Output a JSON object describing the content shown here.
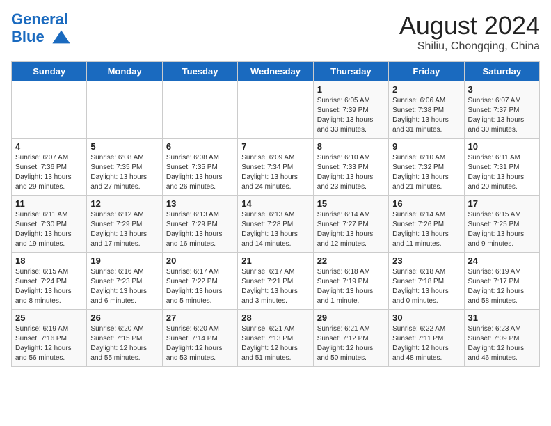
{
  "header": {
    "logo_line1": "General",
    "logo_line2": "Blue",
    "month": "August 2024",
    "location": "Shiliu, Chongqing, China"
  },
  "weekdays": [
    "Sunday",
    "Monday",
    "Tuesday",
    "Wednesday",
    "Thursday",
    "Friday",
    "Saturday"
  ],
  "weeks": [
    [
      {
        "day": "",
        "info": ""
      },
      {
        "day": "",
        "info": ""
      },
      {
        "day": "",
        "info": ""
      },
      {
        "day": "",
        "info": ""
      },
      {
        "day": "1",
        "info": "Sunrise: 6:05 AM\nSunset: 7:39 PM\nDaylight: 13 hours\nand 33 minutes."
      },
      {
        "day": "2",
        "info": "Sunrise: 6:06 AM\nSunset: 7:38 PM\nDaylight: 13 hours\nand 31 minutes."
      },
      {
        "day": "3",
        "info": "Sunrise: 6:07 AM\nSunset: 7:37 PM\nDaylight: 13 hours\nand 30 minutes."
      }
    ],
    [
      {
        "day": "4",
        "info": "Sunrise: 6:07 AM\nSunset: 7:36 PM\nDaylight: 13 hours\nand 29 minutes."
      },
      {
        "day": "5",
        "info": "Sunrise: 6:08 AM\nSunset: 7:35 PM\nDaylight: 13 hours\nand 27 minutes."
      },
      {
        "day": "6",
        "info": "Sunrise: 6:08 AM\nSunset: 7:35 PM\nDaylight: 13 hours\nand 26 minutes."
      },
      {
        "day": "7",
        "info": "Sunrise: 6:09 AM\nSunset: 7:34 PM\nDaylight: 13 hours\nand 24 minutes."
      },
      {
        "day": "8",
        "info": "Sunrise: 6:10 AM\nSunset: 7:33 PM\nDaylight: 13 hours\nand 23 minutes."
      },
      {
        "day": "9",
        "info": "Sunrise: 6:10 AM\nSunset: 7:32 PM\nDaylight: 13 hours\nand 21 minutes."
      },
      {
        "day": "10",
        "info": "Sunrise: 6:11 AM\nSunset: 7:31 PM\nDaylight: 13 hours\nand 20 minutes."
      }
    ],
    [
      {
        "day": "11",
        "info": "Sunrise: 6:11 AM\nSunset: 7:30 PM\nDaylight: 13 hours\nand 19 minutes."
      },
      {
        "day": "12",
        "info": "Sunrise: 6:12 AM\nSunset: 7:29 PM\nDaylight: 13 hours\nand 17 minutes."
      },
      {
        "day": "13",
        "info": "Sunrise: 6:13 AM\nSunset: 7:29 PM\nDaylight: 13 hours\nand 16 minutes."
      },
      {
        "day": "14",
        "info": "Sunrise: 6:13 AM\nSunset: 7:28 PM\nDaylight: 13 hours\nand 14 minutes."
      },
      {
        "day": "15",
        "info": "Sunrise: 6:14 AM\nSunset: 7:27 PM\nDaylight: 13 hours\nand 12 minutes."
      },
      {
        "day": "16",
        "info": "Sunrise: 6:14 AM\nSunset: 7:26 PM\nDaylight: 13 hours\nand 11 minutes."
      },
      {
        "day": "17",
        "info": "Sunrise: 6:15 AM\nSunset: 7:25 PM\nDaylight: 13 hours\nand 9 minutes."
      }
    ],
    [
      {
        "day": "18",
        "info": "Sunrise: 6:15 AM\nSunset: 7:24 PM\nDaylight: 13 hours\nand 8 minutes."
      },
      {
        "day": "19",
        "info": "Sunrise: 6:16 AM\nSunset: 7:23 PM\nDaylight: 13 hours\nand 6 minutes."
      },
      {
        "day": "20",
        "info": "Sunrise: 6:17 AM\nSunset: 7:22 PM\nDaylight: 13 hours\nand 5 minutes."
      },
      {
        "day": "21",
        "info": "Sunrise: 6:17 AM\nSunset: 7:21 PM\nDaylight: 13 hours\nand 3 minutes."
      },
      {
        "day": "22",
        "info": "Sunrise: 6:18 AM\nSunset: 7:19 PM\nDaylight: 13 hours\nand 1 minute."
      },
      {
        "day": "23",
        "info": "Sunrise: 6:18 AM\nSunset: 7:18 PM\nDaylight: 13 hours\nand 0 minutes."
      },
      {
        "day": "24",
        "info": "Sunrise: 6:19 AM\nSunset: 7:17 PM\nDaylight: 12 hours\nand 58 minutes."
      }
    ],
    [
      {
        "day": "25",
        "info": "Sunrise: 6:19 AM\nSunset: 7:16 PM\nDaylight: 12 hours\nand 56 minutes."
      },
      {
        "day": "26",
        "info": "Sunrise: 6:20 AM\nSunset: 7:15 PM\nDaylight: 12 hours\nand 55 minutes."
      },
      {
        "day": "27",
        "info": "Sunrise: 6:20 AM\nSunset: 7:14 PM\nDaylight: 12 hours\nand 53 minutes."
      },
      {
        "day": "28",
        "info": "Sunrise: 6:21 AM\nSunset: 7:13 PM\nDaylight: 12 hours\nand 51 minutes."
      },
      {
        "day": "29",
        "info": "Sunrise: 6:21 AM\nSunset: 7:12 PM\nDaylight: 12 hours\nand 50 minutes."
      },
      {
        "day": "30",
        "info": "Sunrise: 6:22 AM\nSunset: 7:11 PM\nDaylight: 12 hours\nand 48 minutes."
      },
      {
        "day": "31",
        "info": "Sunrise: 6:23 AM\nSunset: 7:09 PM\nDaylight: 12 hours\nand 46 minutes."
      }
    ]
  ]
}
